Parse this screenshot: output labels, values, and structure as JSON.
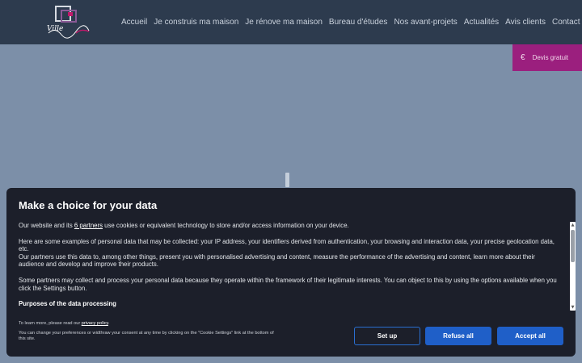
{
  "header": {
    "nav": [
      "Accueil",
      "Je construis ma maison",
      "Je rénove ma maison",
      "Bureau d'études",
      "Nos avant-projets",
      "Actualités",
      "Avis clients",
      "Contact"
    ],
    "logo_text": "Ville"
  },
  "devis": {
    "icon": "€",
    "label": "Devis gratuit"
  },
  "consent": {
    "title": "Make a choice for your data",
    "p1_before": "Our website and its ",
    "p1_link": "6 partners",
    "p1_after": " use cookies or equivalent technology to store and/or access information on your device.",
    "p2": "Here are some examples of personal data that may be collected: your IP address, your identifiers derived from authentication, your browsing and interaction data, your precise geolocation data, etc.",
    "p3": "Our partners use this data to, among other things, present you with personalised advertising and content, measure the performance of the advertising and content, learn more about their audience and develop and improve their products.",
    "p4": "Some partners may collect and process your personal data because they operate within the framework of their legitimate interests. You can object to this by using the options available when you click the Settings button.",
    "purposes_heading": "Purposes of the data processing",
    "footer_line1_before": "To learn more, please read our ",
    "footer_line1_link": "privacy policy",
    "footer_line1_after": ".",
    "footer_line2": "You can change your preferences or widthraw your consent at any time by clicking on the \"Cookie Settings\" link at the bottom of this site.",
    "btn_setup": "Set up",
    "btn_refuse": "Refuse all",
    "btn_accept": "Accept all"
  },
  "colors": {
    "header_bg": "#2d3b4e",
    "page_bg": "#7c8fa8",
    "devis_bg": "#9b1f7e",
    "modal_bg": "#1c1f2a",
    "button_blue": "#1f5fc8",
    "logo_accent": "#c2186b"
  }
}
